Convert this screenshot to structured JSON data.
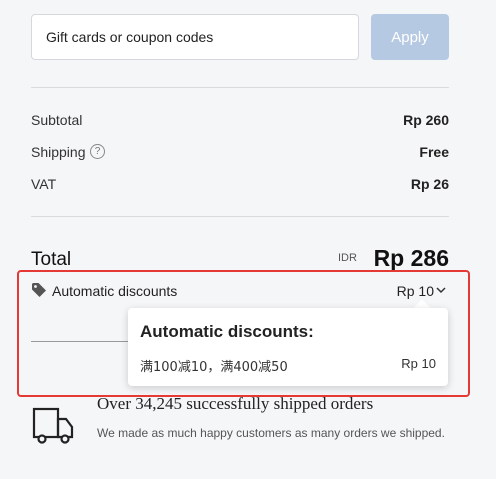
{
  "coupon": {
    "placeholder": "Gift cards or coupon codes",
    "apply_label": "Apply"
  },
  "summary": {
    "subtotal_label": "Subtotal",
    "subtotal_value": "Rp 260",
    "shipping_label": "Shipping",
    "shipping_value": "Free",
    "vat_label": "VAT",
    "vat_value": "Rp 26"
  },
  "total": {
    "label": "Total",
    "currency": "IDR",
    "value": "Rp 286"
  },
  "discounts": {
    "label": "Automatic discounts",
    "value": "Rp 10",
    "popup_title": "Automatic discounts:",
    "popup_item": "满100减10，满400减50",
    "popup_item_value": "Rp 10"
  },
  "trust": {
    "title": "Over 34,245 successfully shipped orders",
    "text": "We made as much happy customers as many orders we shipped."
  },
  "colors": {
    "apply_button": "#b6c9e2",
    "highlight": "#e53935",
    "background": "#f5f6f8"
  },
  "icons": [
    "help-icon",
    "tag-icon",
    "chevron-down-icon",
    "truck-icon"
  ]
}
